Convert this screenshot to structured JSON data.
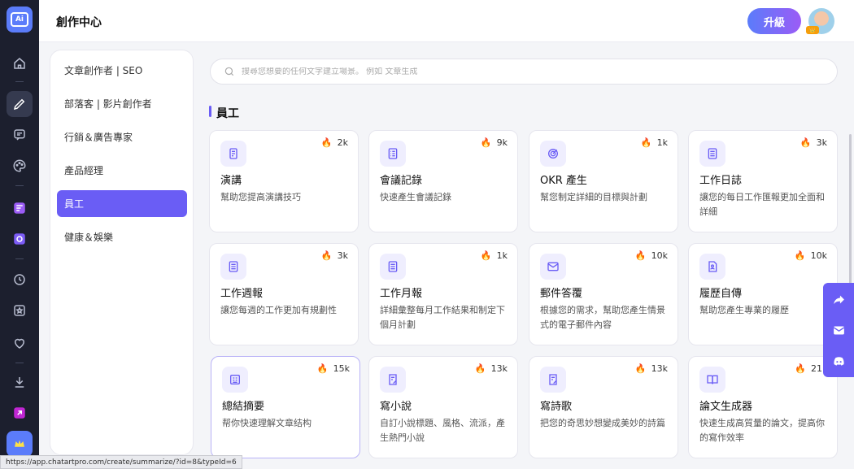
{
  "header": {
    "title": "創作中心",
    "upgrade_label": "升級",
    "avatar_badge": "👑"
  },
  "search": {
    "placeholder": "搜尋您想要的任何文字建立場景。 例如 文章生成"
  },
  "categories": [
    {
      "label": "文章創作者 | SEO",
      "active": false
    },
    {
      "label": "部落客 | 影片創作者",
      "active": false
    },
    {
      "label": "行銷＆廣告專家",
      "active": false
    },
    {
      "label": "產品經理",
      "active": false
    },
    {
      "label": "員工",
      "active": true
    },
    {
      "label": "健康＆娛樂",
      "active": false
    }
  ],
  "section": {
    "title": "員工"
  },
  "cards": [
    {
      "title": "演講",
      "hot": "2k",
      "desc": "幫助您提高演講技巧",
      "icon": "speech-icon"
    },
    {
      "title": "會議記錄",
      "hot": "9k",
      "desc": "快速產生會議記錄",
      "icon": "meeting-notes-icon"
    },
    {
      "title": "OKR 產生",
      "hot": "1k",
      "desc": "幫您制定詳細的目標與計劃",
      "icon": "target-icon"
    },
    {
      "title": "工作日誌",
      "hot": "3k",
      "desc": "讓您的每日工作匯報更加全面和詳細",
      "icon": "journal-icon"
    },
    {
      "title": "工作週報",
      "hot": "3k",
      "desc": "讓您每週的工作更加有規劃性",
      "icon": "weekly-report-icon"
    },
    {
      "title": "工作月報",
      "hot": "1k",
      "desc": "詳細彙整每月工作結果和制定下個月計劃",
      "icon": "monthly-report-icon"
    },
    {
      "title": "郵件答覆",
      "hot": "10k",
      "desc": "根據您的需求，幫助您產生情景式的電子郵件內容",
      "icon": "mail-reply-icon"
    },
    {
      "title": "履歷自傳",
      "hot": "10k",
      "desc": "幫助您產生專業的履歷",
      "icon": "resume-icon"
    },
    {
      "title": "總結摘要",
      "hot": "15k",
      "desc": "帮你快速理解文章结构",
      "icon": "summary-icon"
    },
    {
      "title": "寫小說",
      "hot": "13k",
      "desc": "自訂小說標題、風格、流派，產生熱門小說",
      "icon": "write-novel-icon"
    },
    {
      "title": "寫詩歌",
      "hot": "13k",
      "desc": "把您的奇思妙想變成美妙的詩篇",
      "icon": "write-poem-icon"
    },
    {
      "title": "論文生成器",
      "hot": "21",
      "desc": "快速生成高質量的論文，提高你的寫作效率",
      "icon": "book-icon"
    }
  ],
  "status_url": "https://app.chatartpro.com/create/summarize/?id=8&typeId=6",
  "colors": {
    "accent": "#6a5df5",
    "rail": "#1c1f2e",
    "fire": "#f97316"
  }
}
